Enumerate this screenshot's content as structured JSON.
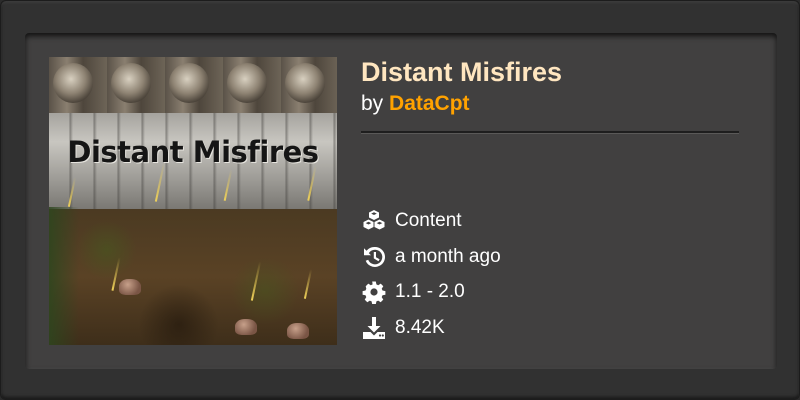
{
  "mod": {
    "title": "Distant Misfires",
    "by_prefix": "by",
    "author": "DataCpt",
    "thumbnail_text": "Distant Misfires",
    "meta": {
      "category": "Content",
      "updated": "a month ago",
      "versions": "1.1 - 2.0",
      "downloads": "8.42K"
    },
    "icons": {
      "category": "cubes-icon",
      "updated": "history-icon",
      "versions": "gear-icon",
      "downloads": "download-icon"
    },
    "colors": {
      "title": "#ffe6c0",
      "author": "#ffa200",
      "card_bg": "#414040"
    }
  }
}
